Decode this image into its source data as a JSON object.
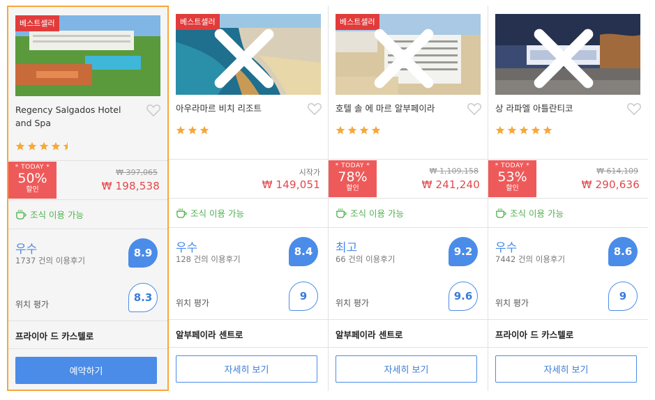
{
  "hotels": [
    {
      "badge": "베스트셀러",
      "name": "Regency Salgados Hotel and Spa",
      "stars": 4.5,
      "deal": {
        "today": "* TODAY *",
        "percent": "50%",
        "sub": "할인"
      },
      "old_price": "₩ 397,065",
      "price": "₩ 198,538",
      "breakfast": "조식 이용 가능",
      "rating_word": "우수",
      "reviews": "1737 건의 이용후기",
      "score": "8.9",
      "location_label": "위치 평가",
      "location_score": "8.3",
      "area": "프라이아 드 카스텔로",
      "button": "예약하기"
    },
    {
      "name": "아우라마르 비치 리조트",
      "stars": 3,
      "from_label": "시작가",
      "price": "₩ 149,051",
      "breakfast": "조식 이용 가능",
      "rating_word": "우수",
      "reviews": "128 건의 이용후기",
      "score": "8.4",
      "location_label": "위치 평가",
      "location_score": "9",
      "area": "알부페이라 센트로",
      "button": "자세히 보기",
      "badge": "베스트셀러"
    },
    {
      "badge": "베스트셀러",
      "name": "호텔 솔 에 마르 알부페이라",
      "stars": 4,
      "deal": {
        "today": "* TODAY *",
        "percent": "78%",
        "sub": "할인"
      },
      "old_price": "₩ 1,109,158",
      "price": "₩ 241,240",
      "breakfast": "조식 이용 가능",
      "rating_word": "최고",
      "reviews": "66 건의 이용후기",
      "score": "9.2",
      "location_label": "위치 평가",
      "location_score": "9.6",
      "area": "알부페이라 센트로",
      "button": "자세히 보기"
    },
    {
      "name": "상 라파엘 아틀란티코",
      "stars": 5,
      "deal": {
        "today": "* TODAY *",
        "percent": "53%",
        "sub": "할인"
      },
      "old_price": "₩ 614,109",
      "price": "₩ 290,636",
      "breakfast": "조식 이용 가능",
      "rating_word": "우수",
      "reviews": "7442 건의 이용후기",
      "score": "8.6",
      "location_label": "위치 평가",
      "location_score": "9",
      "area": "프라이아 드 카스텔로",
      "button": "자세히 보기"
    }
  ],
  "colors": {
    "accent": "#4a8ce8",
    "deal_red": "#ee5a5a",
    "price_red": "#e2474b",
    "badge_red": "#e23b3b",
    "breakfast_green": "#4fb04f",
    "star_orange": "#f7a738",
    "selected_border": "#f7a738"
  },
  "icons": [
    "close-icon",
    "heart-icon",
    "star-icon",
    "half-star-icon",
    "coffee-cup-icon"
  ]
}
